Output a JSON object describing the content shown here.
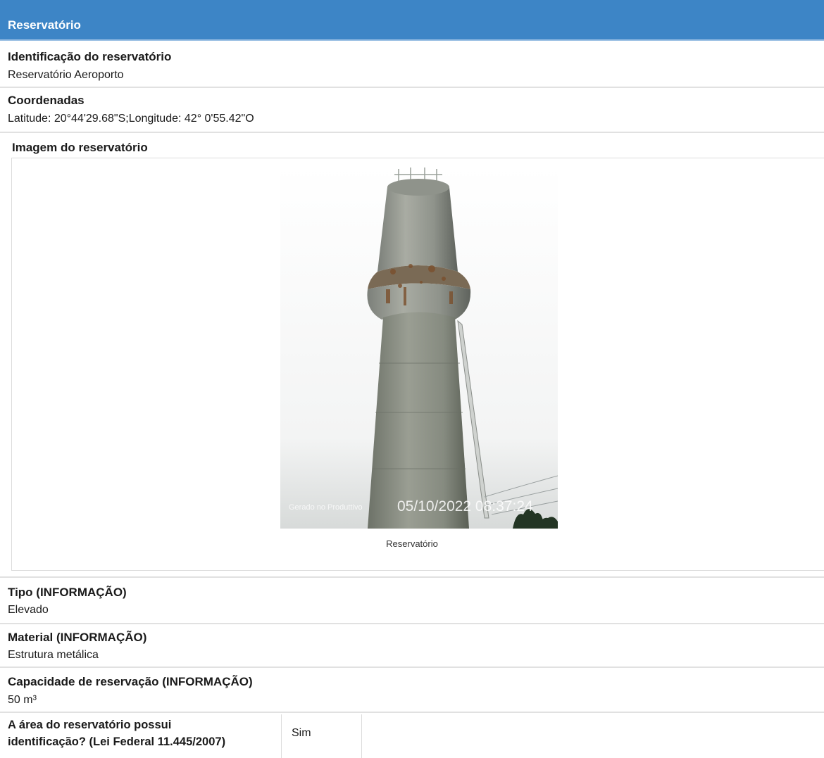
{
  "header": {
    "title": "Reservatório"
  },
  "identificacao": {
    "label": "Identificação do reservatório",
    "value": "Reservatório Aeroporto"
  },
  "coordenadas": {
    "label": "Coordenadas",
    "value": "Latitude: 20°44'29.68\"S;Longitude: 42° 0'55.42\"O"
  },
  "imagem": {
    "label": "Imagem do reservatório",
    "watermark_left": "Gerado no Produttivo",
    "watermark_timestamp": "05/10/2022 08:37:24",
    "caption": "Reservatório"
  },
  "tipo": {
    "label": "Tipo (INFORMAÇÃO)",
    "value": "Elevado"
  },
  "material": {
    "label": "Material (INFORMAÇÃO)",
    "value": "Estrutura metálica"
  },
  "capacidade": {
    "label": "Capacidade de reservação (INFORMAÇÃO)",
    "value": "50 m³"
  },
  "identificacao_area": {
    "question_line1": "A área do reservatório possui",
    "question_line2": "identificação? (Lei Federal 11.445/2007)",
    "answer": "Sim"
  },
  "colors": {
    "header_bg": "#3d85c6",
    "separator": "#e1e1e1"
  }
}
